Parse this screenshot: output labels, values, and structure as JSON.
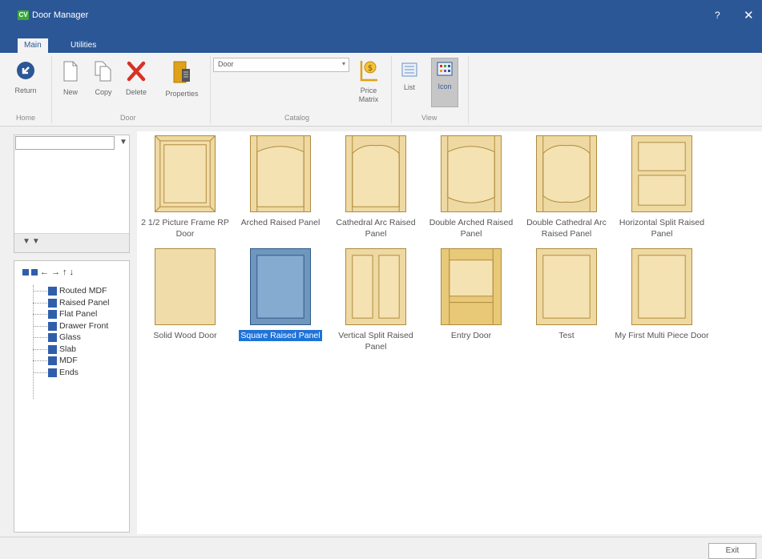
{
  "window": {
    "title": "Door Manager",
    "logo_text": "CV",
    "help": "?",
    "close": "✕"
  },
  "tabs": [
    {
      "label": "Main"
    },
    {
      "label": "Utilities"
    }
  ],
  "ribbon": {
    "return": "Return",
    "new": "New",
    "copy": "Copy",
    "delete": "Delete",
    "properties": "Properties",
    "catalog_value": "Door",
    "price_matrix": "Price\nMatrix",
    "list": "List",
    "icon": "Icon",
    "groups": {
      "home": "Home",
      "door": "Door",
      "catalog": "Catalog",
      "view": "View"
    }
  },
  "left": {
    "filter_value": "",
    "tree_items": [
      {
        "label": "Routed MDF"
      },
      {
        "label": "Raised Panel"
      },
      {
        "label": "Flat Panel"
      },
      {
        "label": "Drawer Front"
      },
      {
        "label": "Glass"
      },
      {
        "label": "Slab"
      },
      {
        "label": "MDF"
      },
      {
        "label": "Ends"
      }
    ]
  },
  "doors": [
    {
      "label": "2 1/2 Picture Frame RP Door",
      "style": "picture"
    },
    {
      "label": "Arched Raised Panel",
      "style": "arched"
    },
    {
      "label": "Cathedral Arc Raised Panel",
      "style": "cathedral"
    },
    {
      "label": "Double Arched Raised Panel",
      "style": "double-arched"
    },
    {
      "label": "Double Cathedral Arc Raised Panel",
      "style": "double-cathedral"
    },
    {
      "label": "Horizontal Split Raised Panel",
      "style": "horizontal-split"
    },
    {
      "label": "Solid Wood Door",
      "style": "solid"
    },
    {
      "label": "Square Raised Panel",
      "style": "square",
      "selected": true
    },
    {
      "label": "Vertical Split Raised Panel",
      "style": "vertical-split"
    },
    {
      "label": "Entry Door",
      "style": "entry"
    },
    {
      "label": "Test",
      "style": "square"
    },
    {
      "label": "My First Multi Piece Door",
      "style": "square"
    }
  ],
  "footer": {
    "exit": "Exit"
  }
}
